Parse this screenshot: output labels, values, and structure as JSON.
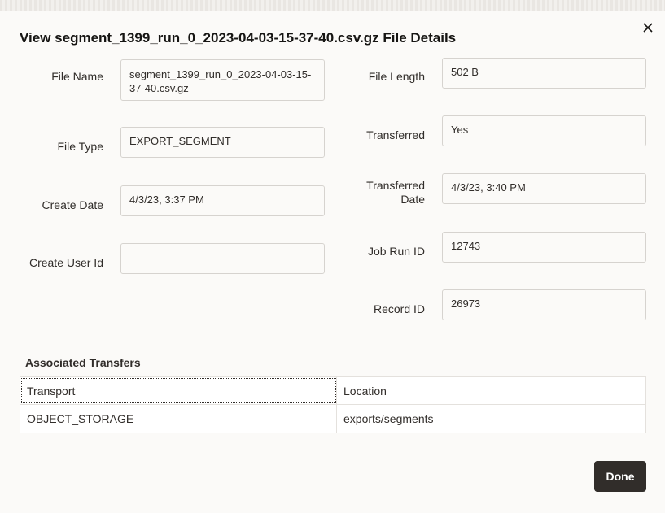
{
  "dialog": {
    "title": "View segment_1399_run_0_2023-04-03-15-37-40.csv.gz File Details",
    "close_icon": "close-icon"
  },
  "fields": {
    "file_name": {
      "label": "File Name",
      "value": "segment_1399_run_0_2023-04-03-15-37-40.csv.gz"
    },
    "file_type": {
      "label": "File Type",
      "value": "EXPORT_SEGMENT"
    },
    "create_date": {
      "label": "Create Date",
      "value": "4/3/23, 3:37 PM"
    },
    "create_user_id": {
      "label": "Create User Id",
      "value": ""
    },
    "file_length": {
      "label": "File Length",
      "value": "502 B"
    },
    "transferred": {
      "label": "Transferred",
      "value": "Yes"
    },
    "transferred_date": {
      "label": "Transferred Date",
      "value": "4/3/23, 3:40 PM"
    },
    "job_run_id": {
      "label": "Job Run ID",
      "value": "12743"
    },
    "record_id": {
      "label": "Record ID",
      "value": "26973"
    }
  },
  "transfers": {
    "title": "Associated Transfers",
    "columns": [
      "Transport",
      "Location"
    ],
    "rows": [
      [
        "OBJECT_STORAGE",
        "exports/segments"
      ]
    ]
  },
  "actions": {
    "done_label": "Done"
  }
}
